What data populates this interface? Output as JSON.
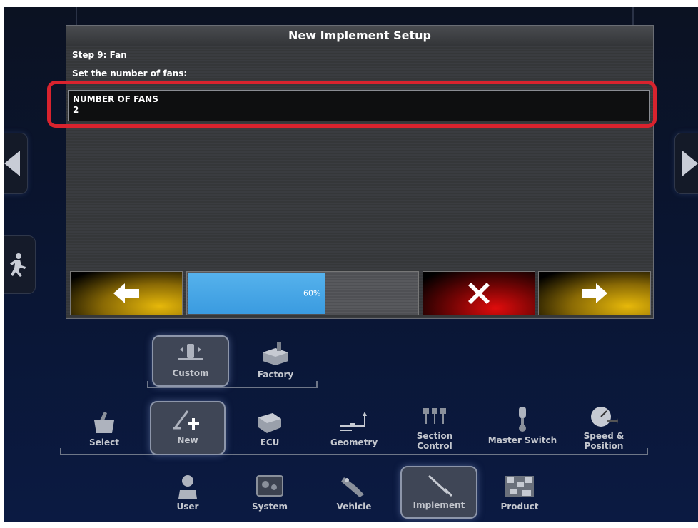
{
  "dialog": {
    "title": "New Implement Setup",
    "step": "Step 9: Fan",
    "instruction": "Set the number of fans:",
    "field_label": "NUMBER OF FANS",
    "field_value": "2",
    "progress_text": "60%",
    "progress_fraction": 0.6
  },
  "setup_options": [
    {
      "label": "Custom",
      "icon": "custom-implement-icon",
      "selected": true
    },
    {
      "label": "Factory",
      "icon": "factory-icon",
      "selected": false
    }
  ],
  "implement_menu": [
    {
      "label": "Select",
      "icon": "select-basket-icon",
      "selected": false
    },
    {
      "label": "New",
      "icon": "new-implement-icon",
      "selected": true
    },
    {
      "label": "ECU",
      "icon": "ecu-icon",
      "selected": false
    },
    {
      "label": "Geometry",
      "icon": "geometry-icon",
      "selected": false
    },
    {
      "label": "Section\nControl",
      "icon": "section-control-icon",
      "selected": false
    },
    {
      "label": "Master Switch",
      "icon": "master-switch-icon",
      "selected": false
    },
    {
      "label": "Speed &\nPosition",
      "icon": "speed-position-icon",
      "selected": false
    }
  ],
  "main_menu": [
    {
      "label": "User",
      "icon": "user-icon",
      "selected": false
    },
    {
      "label": "System",
      "icon": "system-icon",
      "selected": false
    },
    {
      "label": "Vehicle",
      "icon": "vehicle-icon",
      "selected": false
    },
    {
      "label": "Implement",
      "icon": "implement-icon",
      "selected": true
    },
    {
      "label": "Product",
      "icon": "product-icon",
      "selected": false
    }
  ],
  "colors": {
    "highlight": "#d8232e",
    "progress": "#3a9be0",
    "nav_yellow": "#e6b80a",
    "nav_red": "#e00c0c"
  }
}
